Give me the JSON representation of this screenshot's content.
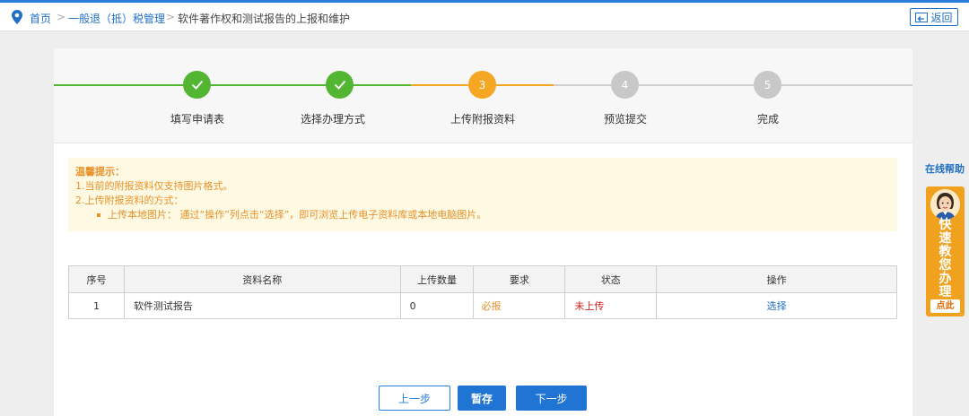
{
  "breadcrumb": {
    "home": "首页",
    "sep1": ">",
    "section": "一般退（抵）税管理",
    "sep2": ">",
    "current": "软件著作权和测试报告的上报和维护"
  },
  "header": {
    "back_label": "返回"
  },
  "steps": [
    {
      "number": "1",
      "label": "填写申请表",
      "state": "done"
    },
    {
      "number": "2",
      "label": "选择办理方式",
      "state": "done"
    },
    {
      "number": "3",
      "label": "上传附报资料",
      "state": "active"
    },
    {
      "number": "4",
      "label": "预览提交",
      "state": "todo"
    },
    {
      "number": "5",
      "label": "完成",
      "state": "todo"
    }
  ],
  "notice": {
    "title": "温馨提示：",
    "line1": "1.当前的附报资料仅支持图片格式。",
    "line2": "2.上传附报资料的方式：",
    "bullet": "上传本地图片： 通过“操作”列点击“选择”，即可浏览上传电子资料库或本地电脑图片。"
  },
  "table": {
    "headers": [
      "序号",
      "资料名称",
      "上传数量",
      "要求",
      "状态",
      "操作"
    ],
    "rows": [
      {
        "index": "1",
        "name": "软件测试报告",
        "count": "0",
        "requirement": "必报",
        "status": "未上传",
        "action": "选择"
      }
    ]
  },
  "buttons": {
    "prev": "上一步",
    "save": "暂存",
    "next": "下一步"
  },
  "side": {
    "help": "在线帮助",
    "helper_chars": [
      "快",
      "速",
      "教",
      "您",
      "办",
      "理"
    ],
    "click_here": "点此"
  },
  "colors": {
    "accent": "#1f74d4",
    "done": "#52b633",
    "active": "#f5a623",
    "todo": "#c8c8c8",
    "notice_text": "#e8912a"
  }
}
